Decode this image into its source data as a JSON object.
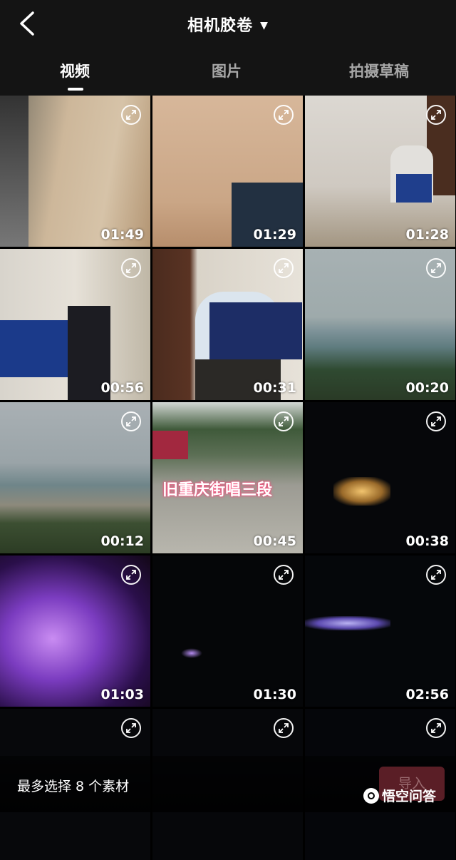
{
  "header": {
    "title": "相机胶卷",
    "caret": "▼",
    "back_icon": "chevron-left-icon"
  },
  "tabs": [
    {
      "label": "视频",
      "active": true
    },
    {
      "label": "图片",
      "active": false
    },
    {
      "label": "拍摄草稿",
      "active": false
    }
  ],
  "videos": [
    {
      "duration": "01:49"
    },
    {
      "duration": "01:29"
    },
    {
      "duration": "01:28"
    },
    {
      "duration": "00:56"
    },
    {
      "duration": "00:31"
    },
    {
      "duration": "00:20"
    },
    {
      "duration": "00:12"
    },
    {
      "duration": "00:45",
      "overlay": "旧重庆街唱三段"
    },
    {
      "duration": "00:38"
    },
    {
      "duration": "01:03"
    },
    {
      "duration": "01:30"
    },
    {
      "duration": "02:56"
    },
    {
      "duration": ""
    },
    {
      "duration": ""
    },
    {
      "duration": ""
    }
  ],
  "footer": {
    "limit_text": "最多选择 8 个素材",
    "import_label": "导入"
  },
  "watermark": "悟空问答",
  "colors": {
    "accent": "#fe2c55",
    "import_disabled_bg": "#5a1e26"
  }
}
